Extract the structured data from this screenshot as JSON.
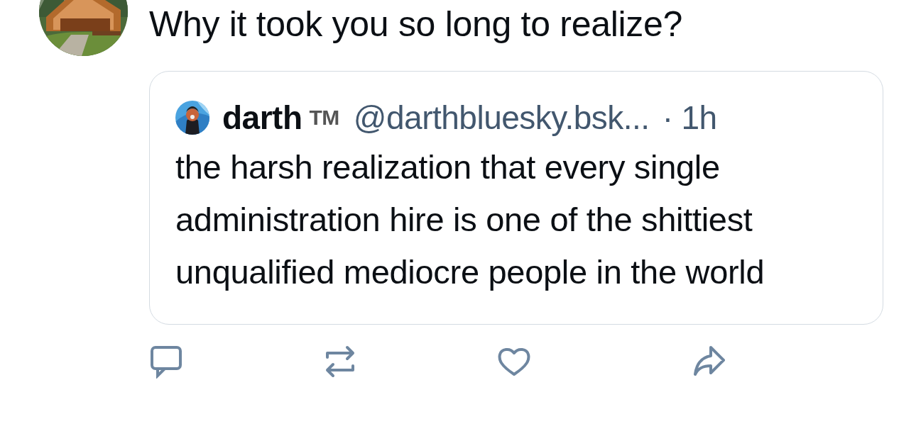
{
  "post": {
    "text": "Why it took you so long to realize?",
    "quote": {
      "author_name": "darth",
      "badge": "TM",
      "handle": "@darthbluesky.bsk...",
      "separator": "·",
      "time": "1h",
      "text": "the harsh realization that every single administration hire is one of the shittiest unqualified mediocre people in the world"
    },
    "actions": [
      {
        "kind": "reply"
      },
      {
        "kind": "repost"
      },
      {
        "kind": "like"
      },
      {
        "kind": "share"
      }
    ]
  }
}
